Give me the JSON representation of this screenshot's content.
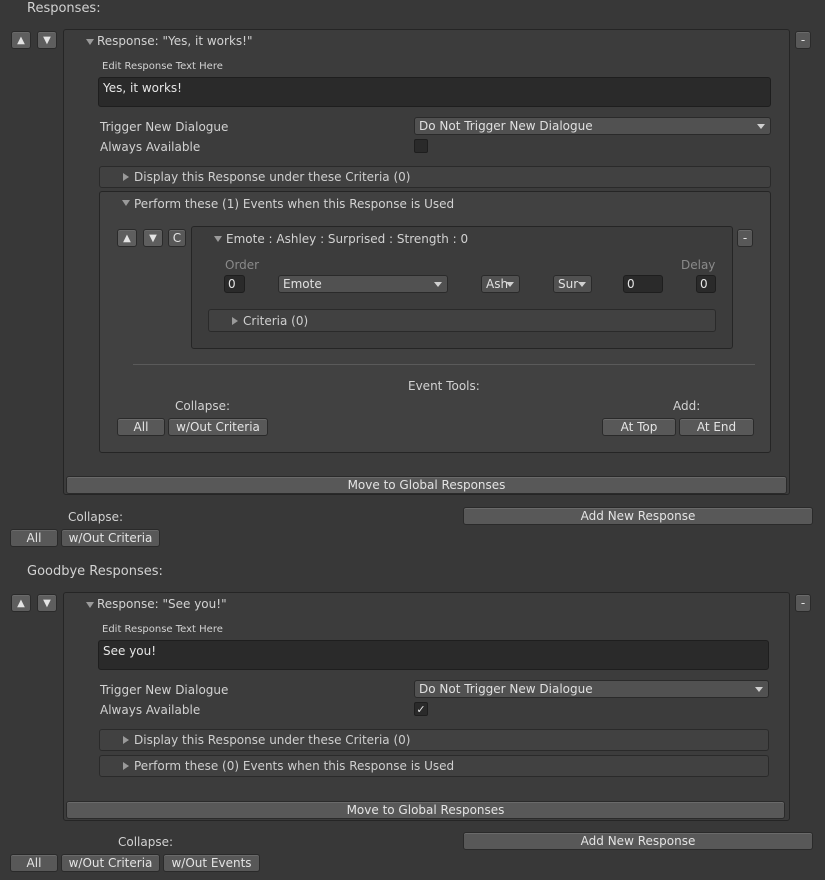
{
  "responses_section": {
    "title": "Responses:",
    "response": {
      "header": "Response: \"Yes, it works!\"",
      "edit_label": "Edit Response Text Here",
      "text": "Yes, it works!",
      "trigger_label": "Trigger New Dialogue",
      "trigger_value": "Do Not Trigger New Dialogue",
      "always_label": "Always Available",
      "always_checked": false,
      "criteria_foldout": "Display this Response under these Criteria (0)",
      "events_foldout": "Perform these (1) Events when this Response is Used",
      "event": {
        "header": "Emote : Ashley : Surprised : Strength : 0",
        "order_label": "Order",
        "delay_label": "Delay",
        "order_value": "0",
        "type_value": "Emote",
        "character_value": "Ash",
        "emotion_value": "Sur",
        "strength_value": "0",
        "delay_value": "0",
        "criteria_foldout": "Criteria (0)",
        "copy_label": "C",
        "remove_label": "-"
      },
      "event_tools_label": "Event Tools:",
      "collapse_label": "Collapse:",
      "add_label": "Add:",
      "all_label": "All",
      "wout_criteria_label": "w/Out Criteria",
      "at_top_label": "At Top",
      "at_end_label": "At End",
      "move_global_label": "Move to Global Responses",
      "remove_label": "-"
    },
    "collapse_label": "Collapse:",
    "all_label": "All",
    "wout_criteria_label": "w/Out Criteria",
    "add_new_label": "Add New Response"
  },
  "goodbye_section": {
    "title": "Goodbye Responses:",
    "response": {
      "header": "Response: \"See you!\"",
      "edit_label": "Edit Response Text Here",
      "text": "See you!",
      "trigger_label": "Trigger New Dialogue",
      "trigger_value": "Do Not Trigger New Dialogue",
      "always_label": "Always Available",
      "always_checked": true,
      "check_glyph": "✓",
      "criteria_foldout": "Display this Response under these Criteria (0)",
      "events_foldout": "Perform these (0) Events when this Response is Used",
      "move_global_label": "Move to Global Responses",
      "remove_label": "-"
    },
    "collapse_label": "Collapse:",
    "all_label": "All",
    "wout_criteria_label": "w/Out Criteria",
    "wout_events_label": "w/Out Events",
    "add_new_label": "Add New Response"
  }
}
